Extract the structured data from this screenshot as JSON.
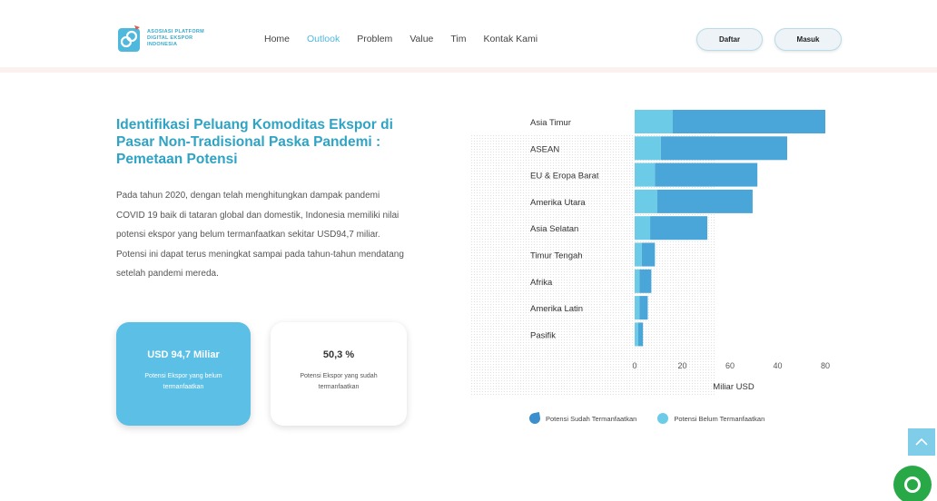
{
  "header": {
    "logo_lines": [
      "ASOSIASI PLATFORM",
      "DIGITAL EKSPOR",
      "INDONESIA"
    ],
    "nav": [
      {
        "label": "Home",
        "active": false
      },
      {
        "label": "Outlook",
        "active": true
      },
      {
        "label": "Problem",
        "active": false
      },
      {
        "label": "Value",
        "active": false
      },
      {
        "label": "Tim",
        "active": false
      },
      {
        "label": "Kontak Kami",
        "active": false
      }
    ],
    "daftar_label": "Daftar",
    "masuk_label": "Masuk"
  },
  "content": {
    "headline": "Identifikasi Peluang Komoditas Ekspor di Pasar Non-Tradisional Paska Pandemi : Pemetaan Potensi",
    "paragraph": "Pada tahun 2020, dengan telah menghitungkan dampak pandemi COVID 19 baik di tataran global dan domestik, Indonesia memiliki nilai potensi ekspor yang belum termanfaatkan sekitar USD94,7 miliar. Potensi ini dapat terus meningkat sampai pada tahun-tahun mendatang setelah pandemi mereda.",
    "card1": {
      "title": "USD 94,7 Miliar",
      "subtitle": "Potensi Ekspor yang belum termanfaatkan"
    },
    "card2": {
      "title": "50,3 %",
      "subtitle": "Potensi Ekspor yang sudah termanfaatkan"
    }
  },
  "chart_data": {
    "type": "bar",
    "orientation": "horizontal",
    "stacked": true,
    "categories": [
      "Asia Timur",
      "ASEAN",
      "EU & Eropa Barat",
      "Amerika Utara",
      "Asia Selatan",
      "Timur Tengah",
      "Afrika",
      "Amerika Latin",
      "Pasifik"
    ],
    "series": [
      {
        "name": "Potensi Belum Termanfaatkan",
        "color": "#6ccbe6",
        "values": [
          16,
          11,
          8.5,
          9.5,
          6.5,
          3,
          2,
          2,
          1.5
        ]
      },
      {
        "name": "Potensi Sudah Termanfaatkan",
        "color": "#4aa6d8",
        "values": [
          64,
          53,
          43,
          40,
          24,
          5.5,
          5,
          3.5,
          2
        ]
      }
    ],
    "xticks": [
      0,
      20,
      60,
      40,
      80
    ],
    "xlim": [
      0,
      80
    ],
    "xlabel": "Miliar USD",
    "legend_position": "bottom"
  },
  "legend": {
    "item1": "Potensi Sudah Termanfaatkan",
    "item2": "Potensi Belum Termanfaatkan"
  },
  "floating": {
    "scroll_top_icon": "chevron-up-icon",
    "chat_icon": "chat-icon"
  }
}
